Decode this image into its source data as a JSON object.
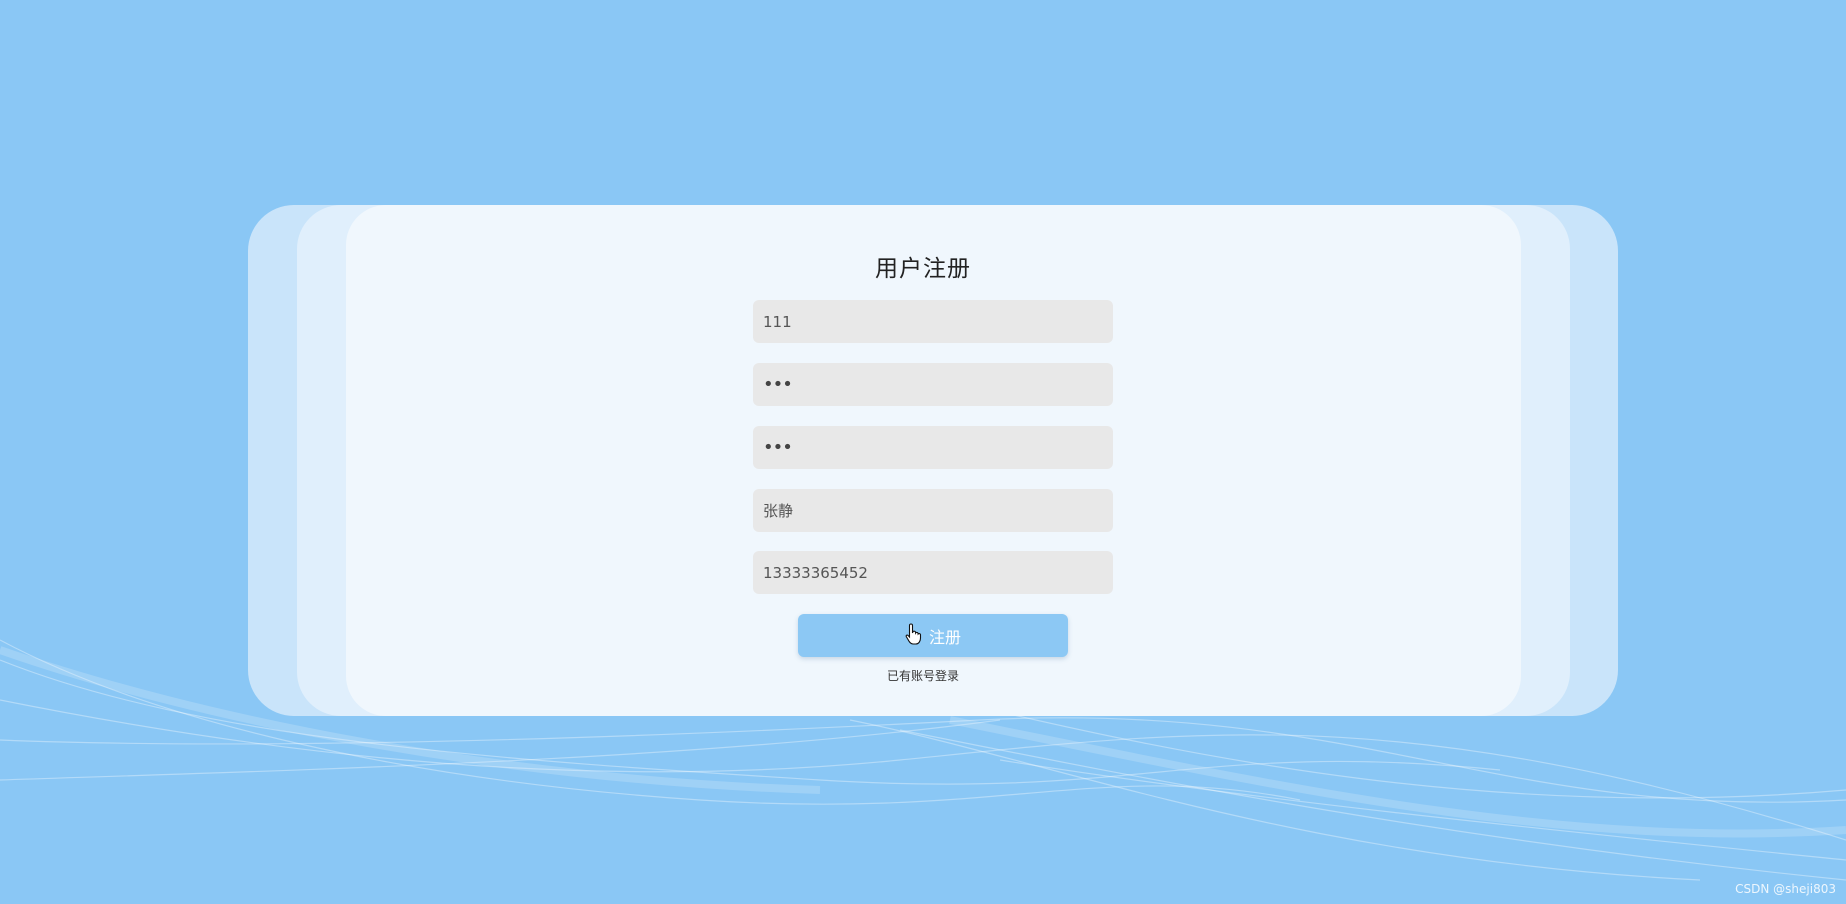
{
  "page": {
    "background_color": "#8ac7f5"
  },
  "form": {
    "title": "用户注册",
    "fields": [
      {
        "name": "username",
        "value": "111"
      },
      {
        "name": "password",
        "value": "•••"
      },
      {
        "name": "confirm-password",
        "value": "•••"
      },
      {
        "name": "real-name",
        "value": "张静"
      },
      {
        "name": "phone",
        "value": "13333365452"
      }
    ],
    "submit_label": "注册",
    "login_link": "已有账号登录"
  },
  "watermark": "CSDN @sheji803",
  "colors": {
    "button": "#8cc8f4",
    "field_bg": "#e8e8e8",
    "panel": "#f0f7fd"
  }
}
